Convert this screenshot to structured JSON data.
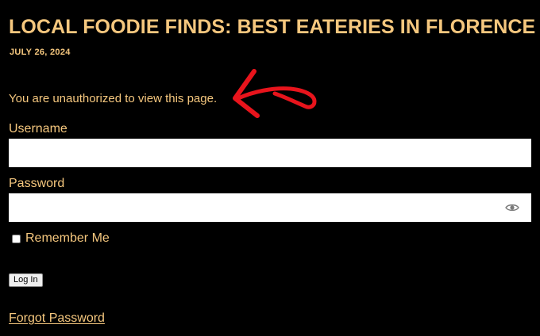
{
  "page": {
    "title": "LOCAL FOODIE FINDS: BEST EATERIES IN FLORENCE",
    "date": "JULY 26, 2024",
    "notice": "You are unauthorized to view this page."
  },
  "form": {
    "username_label": "Username",
    "username_value": "",
    "password_label": "Password",
    "password_value": "",
    "show_password_icon": "eye-icon",
    "remember_label": "Remember Me",
    "remember_checked": false,
    "login_button": "Log In",
    "forgot_link": "Forgot Password"
  },
  "annotation": {
    "arrow_icon": "red-hand-drawn-arrow",
    "arrow_color": "#e8141c"
  },
  "colors": {
    "background": "#000000",
    "text_accent": "#f5c77e",
    "input_background": "#ffffff"
  }
}
